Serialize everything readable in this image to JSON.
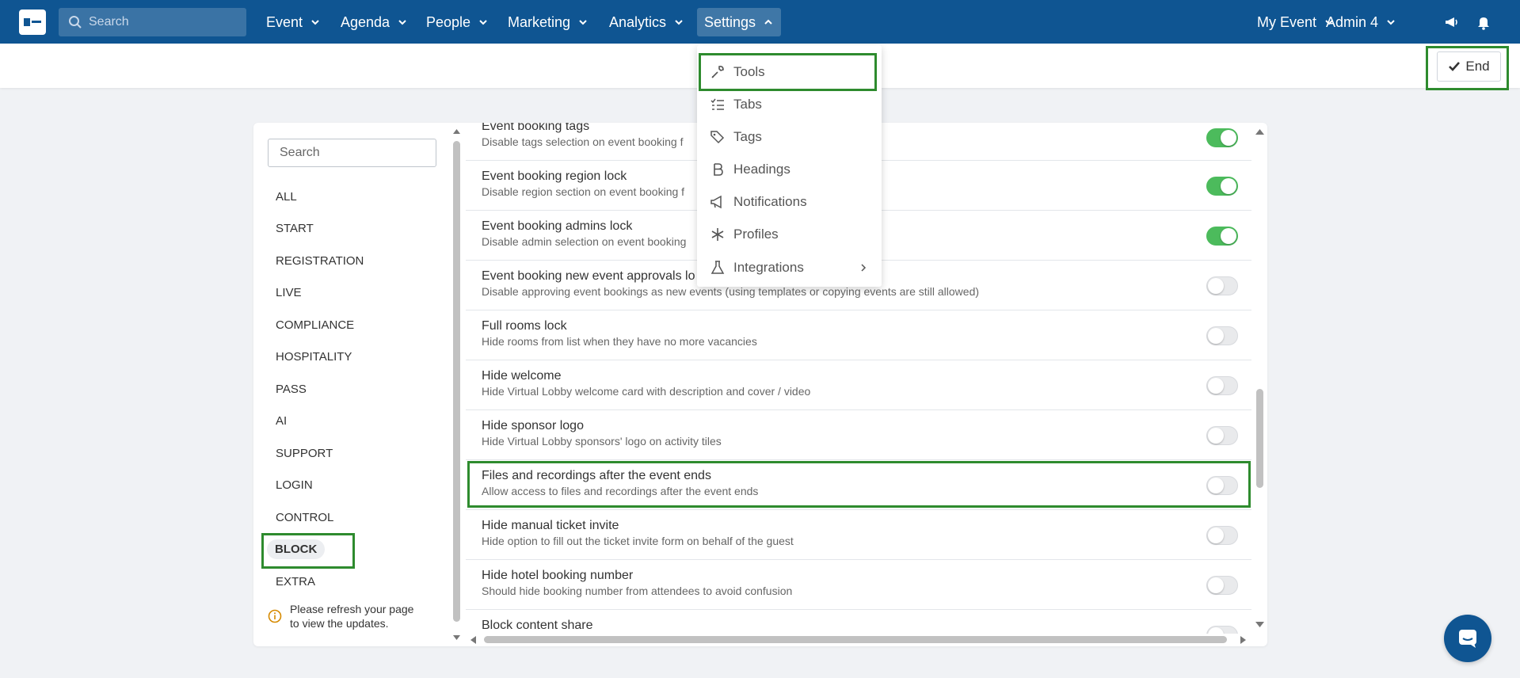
{
  "topnav": {
    "search_placeholder": "Search",
    "items": [
      "Event",
      "Agenda",
      "People",
      "Marketing",
      "Analytics",
      "Settings"
    ],
    "right_items": [
      "My Event",
      "Admin 4"
    ],
    "icons": [
      "megaphone-icon",
      "bell-icon"
    ],
    "brand_color": "#0f5592"
  },
  "subbar": {
    "end_label": "End"
  },
  "sidebar": {
    "search_placeholder": "Search",
    "categories": [
      "ALL",
      "START",
      "REGISTRATION",
      "LIVE",
      "COMPLIANCE",
      "HOSPITALITY",
      "PASS",
      "AI",
      "SUPPORT",
      "LOGIN",
      "CONTROL",
      "BLOCK",
      "EXTRA"
    ],
    "selected": "BLOCK",
    "note_line1": "Please refresh your page",
    "note_line2": "to view the updates."
  },
  "settings": [
    {
      "title": "Event booking tags",
      "desc": "Disable tags selection on event booking f",
      "on": true
    },
    {
      "title": "Event booking region lock",
      "desc": "Disable region section on event booking f",
      "on": true
    },
    {
      "title": "Event booking admins lock",
      "desc": "Disable admin selection on event booking",
      "on": true
    },
    {
      "title": "Event booking new event approvals lo",
      "desc": "Disable approving event bookings as new events (using templates or copying events are still allowed)",
      "on": false
    },
    {
      "title": "Full rooms lock",
      "desc": "Hide rooms from list when they have no more vacancies",
      "on": false
    },
    {
      "title": "Hide welcome",
      "desc": "Hide Virtual Lobby welcome card with description and cover / video",
      "on": false
    },
    {
      "title": "Hide sponsor logo",
      "desc": "Hide Virtual Lobby sponsors' logo on activity tiles",
      "on": false
    },
    {
      "title": "Files and recordings after the event ends",
      "desc": "Allow access to files and recordings after the event ends",
      "on": false
    },
    {
      "title": "Hide manual ticket invite",
      "desc": "Hide option to fill out the ticket invite form on behalf of the guest",
      "on": false
    },
    {
      "title": "Hide hotel booking number",
      "desc": "Should hide booking number from attendees to avoid confusion",
      "on": false
    },
    {
      "title": "Block content share",
      "desc": "",
      "on": false
    }
  ],
  "dropdown": {
    "items": [
      {
        "label": "Tools",
        "icon": "wrench-icon"
      },
      {
        "label": "Tabs",
        "icon": "list-check-icon"
      },
      {
        "label": "Tags",
        "icon": "tags-icon"
      },
      {
        "label": "Headings",
        "icon": "bold-icon"
      },
      {
        "label": "Notifications",
        "icon": "megaphone-icon"
      },
      {
        "label": "Profiles",
        "icon": "asterisk-icon"
      },
      {
        "label": "Integrations",
        "icon": "flask-icon"
      }
    ]
  },
  "colors": {
    "highlight": "#2e8b2e",
    "toggle_on": "#4cbb5c"
  }
}
